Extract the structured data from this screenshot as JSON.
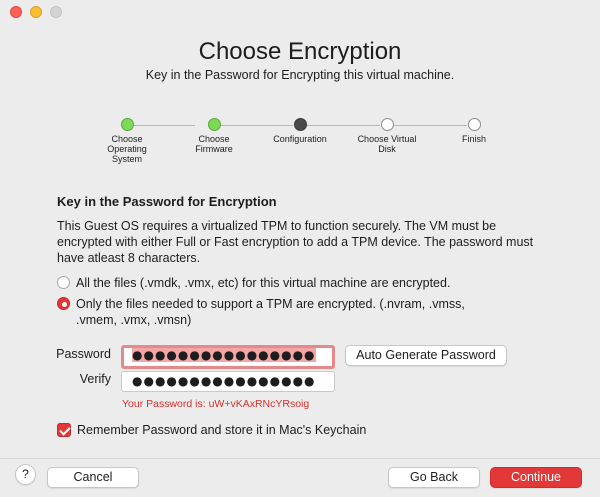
{
  "window": {
    "title": "Choose Encryption",
    "subtitle": "Key in the Password for Encrypting this virtual machine."
  },
  "stepper": {
    "steps": [
      {
        "label": "Choose Operating System",
        "state": "done"
      },
      {
        "label": "Choose Firmware",
        "state": "done"
      },
      {
        "label": "Configuration",
        "state": "current"
      },
      {
        "label": "Choose Virtual Disk",
        "state": "pending"
      },
      {
        "label": "Finish",
        "state": "pending"
      }
    ]
  },
  "section": {
    "title": "Key in the Password for Encryption",
    "description": "This Guest OS requires a virtualized TPM to function securely. The VM must be encrypted with either Full or Fast encryption to add a TPM device. The password must have atleast 8 characters."
  },
  "options": {
    "all_files": {
      "label": "All the files (.vmdk, .vmx, etc) for this virtual machine are encrypted.",
      "selected": false
    },
    "tpm_files": {
      "label": "Only the files needed to support a TPM are encrypted. (.nvram, .vmss, .vmem, .vmx, .vmsn)",
      "selected": true
    }
  },
  "password": {
    "label": "Password",
    "value": "●●●●●●●●●●●●●●●●",
    "verify_label": "Verify",
    "verify_value": "●●●●●●●●●●●●●●●●",
    "auto_generate_label": "Auto Generate Password",
    "message": "Your Password is: uW+vKAxRNcYRsoig"
  },
  "keychain": {
    "label": "Remember Password and store it in Mac's Keychain",
    "checked": true
  },
  "footer": {
    "help_label": "?",
    "cancel_label": "Cancel",
    "back_label": "Go Back",
    "continue_label": "Continue"
  },
  "colors": {
    "accent": "#e23838",
    "done_step": "#7ed957",
    "current_step": "#4a4a4a",
    "error_text": "#d9302c"
  }
}
